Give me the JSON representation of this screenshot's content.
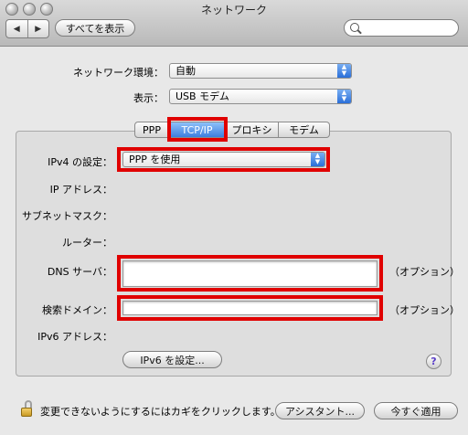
{
  "window": {
    "title": "ネットワーク"
  },
  "toolbar": {
    "back_label": "◀",
    "forward_label": "▶",
    "show_all_label": "すべてを表示",
    "search_placeholder": ""
  },
  "top_form": {
    "location_label": "ネットワーク環境：",
    "location_value": "自動",
    "show_label": "表示：",
    "show_value": "USB モデム"
  },
  "tabs": [
    {
      "label": "PPP"
    },
    {
      "label": "TCP/IP"
    },
    {
      "label": "プロキシ"
    },
    {
      "label": "モデム"
    }
  ],
  "tcpip": {
    "ipv4_label": "IPv4 の設定：",
    "ipv4_value": "PPP を使用",
    "ip_address_label": "IP アドレス：",
    "subnet_label": "サブネットマスク：",
    "router_label": "ルーター：",
    "dns_label": "DNS サーバ：",
    "dns_value": "",
    "dns_optional": "（オプション）",
    "search_domains_label": "検索ドメイン：",
    "search_domains_value": "",
    "search_optional": "（オプション）",
    "ipv6_address_label": "IPv6 アドレス：",
    "configure_ipv6_label": "IPv6 を設定...",
    "help_label": "?"
  },
  "footer": {
    "lock_text": "変更できないようにするにはカギをクリックします。",
    "assistant_label": "アシスタント...",
    "apply_label": "今すぐ適用"
  },
  "colors": {
    "highlight": "#e00000",
    "accent": "#3d7fde"
  }
}
